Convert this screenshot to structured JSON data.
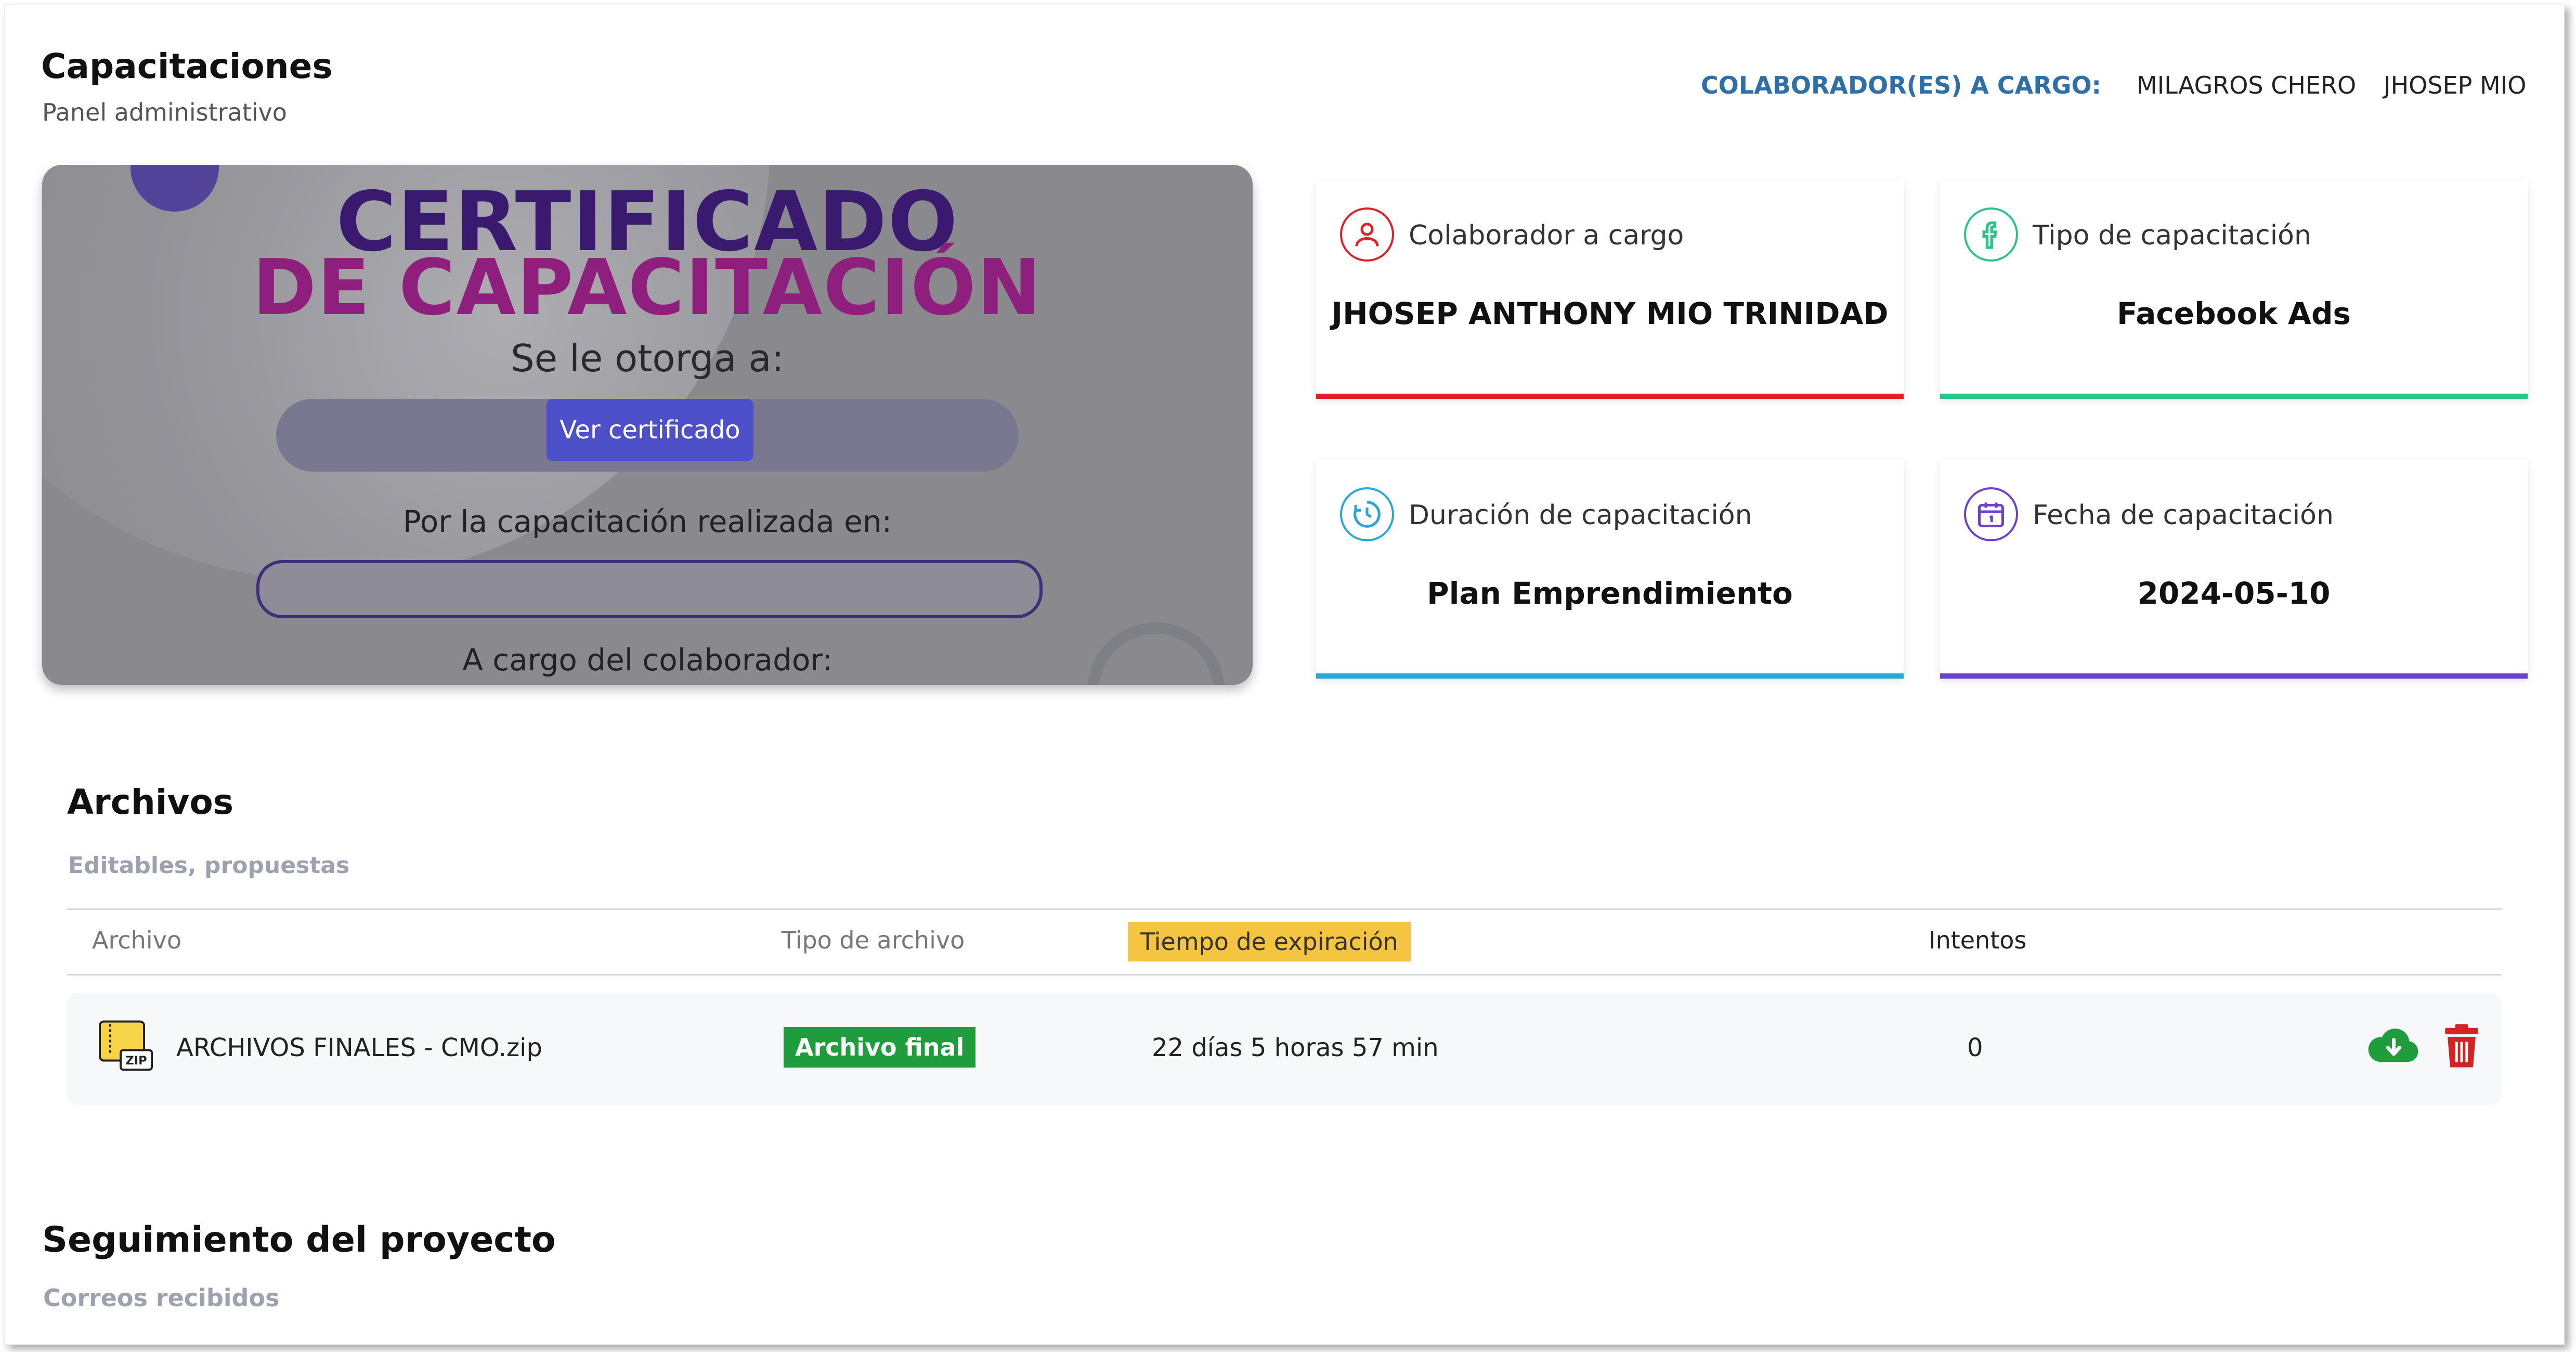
{
  "header": {
    "title": "Capacitaciones",
    "subtitle": "Panel administrativo",
    "collaborators_label": "COLABORADOR(ES) A CARGO:",
    "collaborators": [
      "MILAGROS CHERO",
      "JHOSEP MIO"
    ]
  },
  "certificate": {
    "title_line1": "CERTIFICADO",
    "title_line2": "DE CAPACITACIÓN",
    "granted_to": "Se le otorga a:",
    "button_label": "Ver certificado",
    "training_label": "Por la capacitación realizada en:",
    "collaborator_label": "A cargo del colaborador:"
  },
  "cards": [
    {
      "label": "Colaborador a cargo",
      "value": "JHOSEP ANTHONY MIO TRINIDAD",
      "icon": "user-icon",
      "color": "#e0202a"
    },
    {
      "label": "Tipo de capacitación",
      "value": "Facebook Ads",
      "icon": "facebook-icon",
      "color": "#2bc48a"
    },
    {
      "label": "Duración de capacitación",
      "value": "Plan Emprendimiento",
      "icon": "timer-icon",
      "color": "#2aa7d8"
    },
    {
      "label": "Fecha de capacitación",
      "value": "2024-05-10",
      "icon": "calendar-icon",
      "color": "#6b3fd0"
    }
  ],
  "files": {
    "title": "Archivos",
    "subtitle": "Editables, propuestas",
    "columns": [
      "Archivo",
      "Tipo de archivo",
      "Tiempo de expiración",
      "Intentos"
    ],
    "rows": [
      {
        "name": "ARCHIVOS FINALES - CMO.zip",
        "type": "Archivo final",
        "expiration": "22 días 5 horas 57 min",
        "attempts": "0"
      }
    ]
  },
  "tracking": {
    "title": "Seguimiento del proyecto",
    "subtitle": "Correos recibidos"
  },
  "colors": {
    "accent_blue": "#2f6fa8",
    "button": "#4d50c9",
    "badge_green": "#1f9d3c",
    "highlight": "#f5c542",
    "delete_red": "#d32424",
    "download_green": "#1f9d3c"
  }
}
